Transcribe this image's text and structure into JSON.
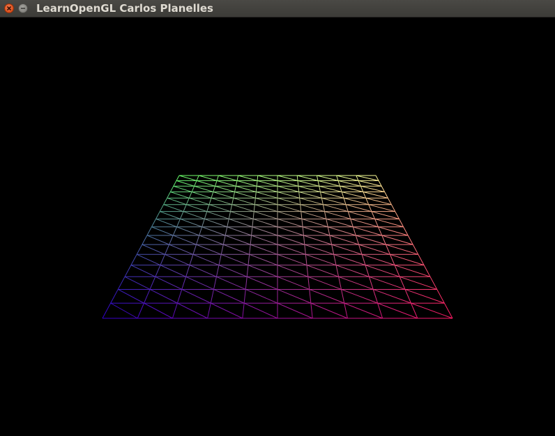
{
  "window": {
    "title": "LearnOpenGL Carlos Planelles",
    "close_icon": "close-icon",
    "minimize_icon": "minimize-icon"
  },
  "scene": {
    "description_kind": "wireframe-grid-plane",
    "render_mode": "wireframe",
    "grid_columns": 10,
    "grid_rows": 16,
    "background_color": "#000000",
    "corner_colors": {
      "far_left": "#66ff66",
      "far_right": "#ffff99",
      "near_left": "#3300cc",
      "near_right": "#ff1a66"
    }
  }
}
